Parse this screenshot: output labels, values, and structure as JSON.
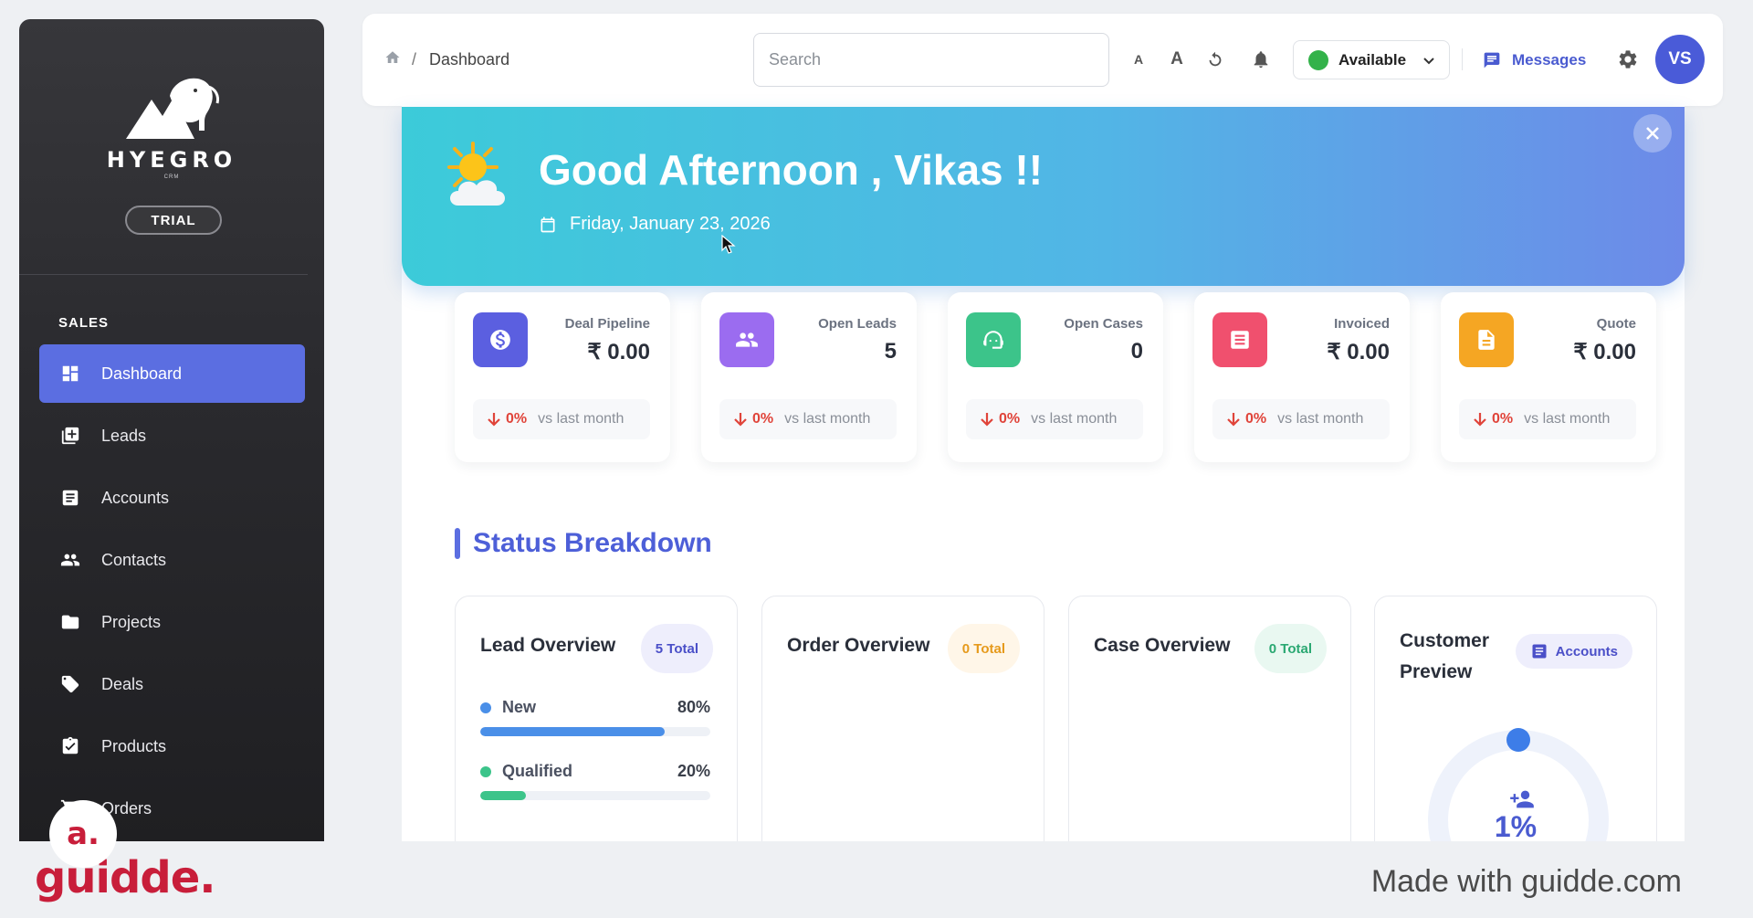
{
  "sidebar": {
    "brand": "HYEGRO",
    "brand_sub": "CRM",
    "plan_badge": "TRIAL",
    "section": "SALES",
    "items": [
      {
        "label": "Dashboard",
        "icon": "dashboard-icon",
        "active": true
      },
      {
        "label": "Leads",
        "icon": "leads-icon"
      },
      {
        "label": "Accounts",
        "icon": "accounts-icon"
      },
      {
        "label": "Contacts",
        "icon": "contacts-icon"
      },
      {
        "label": "Projects",
        "icon": "folder-icon"
      },
      {
        "label": "Deals",
        "icon": "tag-icon"
      },
      {
        "label": "Products",
        "icon": "clipboard-icon"
      },
      {
        "label": "Orders",
        "icon": "cart-icon"
      }
    ]
  },
  "topbar": {
    "breadcrumb": "Dashboard",
    "search_placeholder": "Search",
    "font_small": "A",
    "font_large": "A",
    "status": "Available",
    "status_color": "#33b24a",
    "messages": "Messages",
    "avatar_initials": "VS"
  },
  "welcome": {
    "greeting": "Good Afternoon , Vikas !!",
    "date": "Friday, January 23, 2026"
  },
  "stats": [
    {
      "label": "Deal Pipeline",
      "value": "₹ 0.00",
      "pct": "0%",
      "vs": "vs last month",
      "color": "#5b5fe0"
    },
    {
      "label": "Open Leads",
      "value": "5",
      "pct": "0%",
      "vs": "vs last month",
      "color": "#9b6cf0"
    },
    {
      "label": "Open Cases",
      "value": "0",
      "pct": "0%",
      "vs": "vs last month",
      "color": "#3cc48a"
    },
    {
      "label": "Invoiced",
      "value": "₹ 0.00",
      "pct": "0%",
      "vs": "vs last month",
      "color": "#f0506e"
    },
    {
      "label": "Quote",
      "value": "₹ 0.00",
      "pct": "0%",
      "vs": "vs last month",
      "color": "#f5a623"
    }
  ],
  "status_breakdown": {
    "title": "Status Breakdown",
    "lead": {
      "title": "Lead Overview",
      "total": "5 Total",
      "rows": [
        {
          "label": "New",
          "pct_label": "80%",
          "value": 0.8,
          "color": "#4a8fe8"
        },
        {
          "label": "Qualified",
          "pct_label": "20%",
          "value": 0.2,
          "color": "#3cc48a"
        }
      ]
    },
    "order": {
      "title": "Order Overview",
      "total": "0 Total"
    },
    "case": {
      "title": "Case Overview",
      "total": "0 Total"
    },
    "customer": {
      "title_line1": "Customer",
      "title_line2": "Preview",
      "button": "Accounts",
      "pct": "1%"
    }
  },
  "footer": {
    "logo": "guidde.",
    "badge": "a.",
    "made_with": "Made with guidde.com"
  }
}
